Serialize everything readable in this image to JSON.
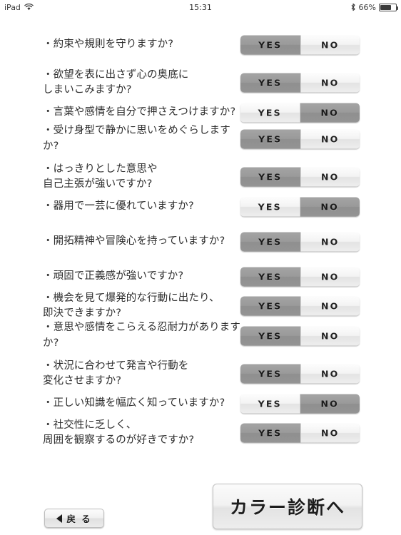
{
  "statusbar": {
    "device_label": "iPad",
    "wifi_icon": "wifi-icon",
    "time": "15:31",
    "bluetooth_icon": "bluetooth-icon",
    "battery_percent": "66%",
    "battery_level": 66
  },
  "toggle": {
    "yes_label": "YES",
    "no_label": "NO",
    "selected_color": "#9a9a9a",
    "unselected_color": "#f1f1f1"
  },
  "questions": [
    {
      "text": "・約束や規則を守りますか?",
      "lines": 1,
      "answer": "YES",
      "gap_before": false
    },
    {
      "text": "・欲望を表に出さず心の奥底に\n しまいこみますか?",
      "lines": 2,
      "answer": "YES",
      "gap_before": true
    },
    {
      "text": "・言葉や感情を自分で押さえつけますか?",
      "lines": 1,
      "answer": "NO",
      "gap_before": false
    },
    {
      "text": "・受け身型で静かに思いをめぐらしますか?",
      "lines": 1,
      "answer": "YES",
      "gap_before": false
    },
    {
      "text": "・はっきりとした意思や\n 自己主張が強いですか?",
      "lines": 2,
      "answer": "YES",
      "gap_before": true
    },
    {
      "text": "・器用で一芸に優れていますか?",
      "lines": 1,
      "answer": "NO",
      "gap_before": false
    },
    {
      "text": "・開拓精神や冒険心を持っていますか?",
      "lines": 1,
      "answer": "YES",
      "gap_before": true
    },
    {
      "text": "・頑固で正義感が強いですか?",
      "lines": 1,
      "answer": "YES",
      "gap_before": true
    },
    {
      "text": "・機会を見て爆発的な行動に出たり、\n 即決できますか?",
      "lines": 2,
      "answer": "YES",
      "gap_before": false
    },
    {
      "text": "・意思や感情をこらえる忍耐力がありますか?",
      "lines": 1,
      "answer": "YES",
      "gap_before": false
    },
    {
      "text": "・状況に合わせて発言や行動を\n 変化させますか?",
      "lines": 2,
      "answer": "YES",
      "gap_before": true
    },
    {
      "text": "・正しい知識を幅広く知っていますか?",
      "lines": 1,
      "answer": "NO",
      "gap_before": false
    },
    {
      "text": "・社交性に乏しく、\n 周囲を観察するのが好きですか?",
      "lines": 2,
      "answer": "YES",
      "gap_before": false
    }
  ],
  "footer": {
    "primary_button_label": "カラー診断へ",
    "back_button_label": "戻 る",
    "back_arrow_icon": "triangle-left-icon"
  }
}
